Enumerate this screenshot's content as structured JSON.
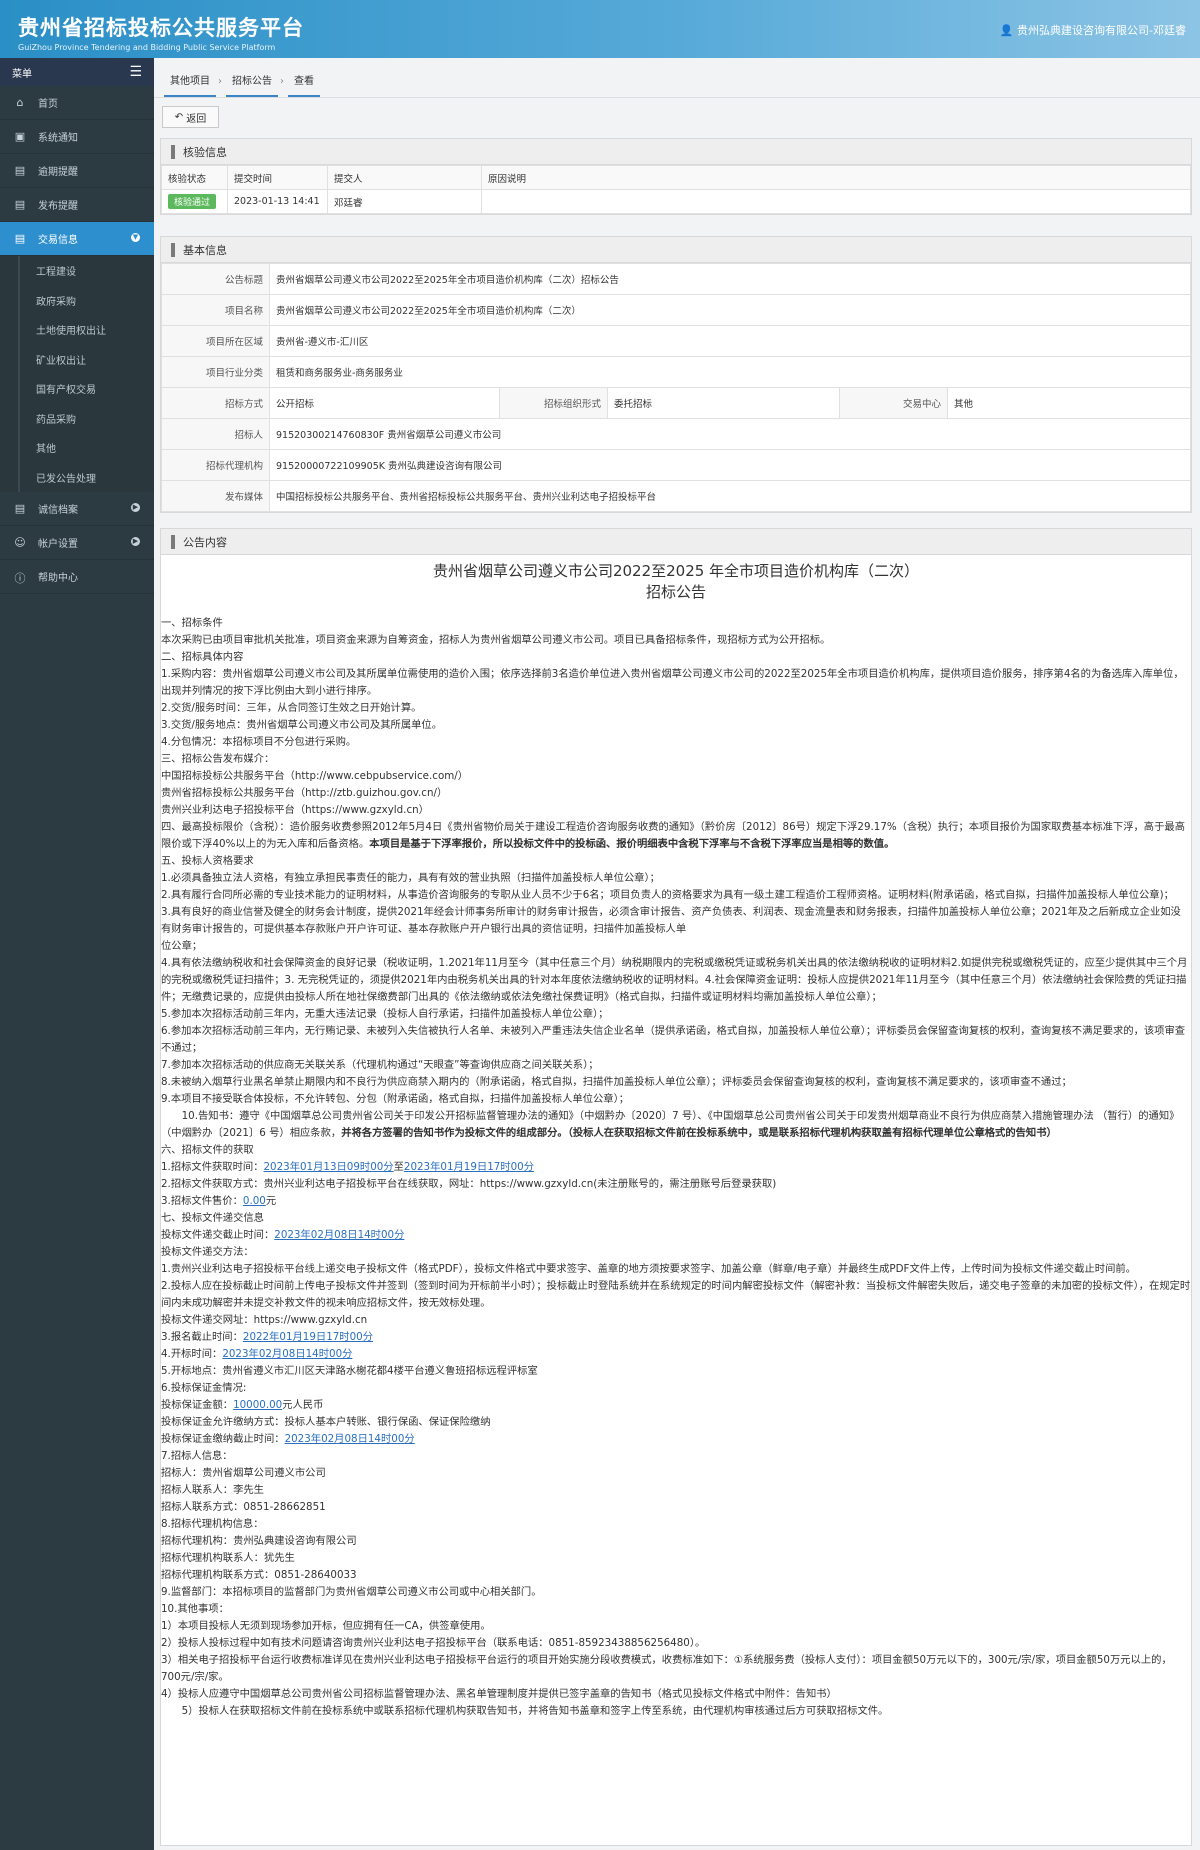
{
  "header": {
    "title": "贵州省招标投标公共服务平台",
    "subtitle": "GuiZhou Province Tendering and Bidding Public Service Platform",
    "user": "贵州弘典建设咨询有限公司-邓廷睿"
  },
  "sidebar": {
    "menu_label": "菜单",
    "items": [
      {
        "label": "首页",
        "icon": "home-icon"
      },
      {
        "label": "系统通知",
        "icon": "monitor-icon"
      },
      {
        "label": "逾期提醒",
        "icon": "list-icon"
      },
      {
        "label": "发布提醒",
        "icon": "list-icon"
      },
      {
        "label": "交易信息",
        "icon": "list-icon"
      }
    ],
    "sub_items": [
      "工程建设",
      "政府采购",
      "土地使用权出让",
      "矿业权出让",
      "国有产权交易",
      "药品采购",
      "其他",
      "已发公告处理"
    ],
    "bottom_items": [
      {
        "label": "诚信档案",
        "icon": "list-icon"
      },
      {
        "label": "帐户设置",
        "icon": "user-icon"
      },
      {
        "label": "帮助中心",
        "icon": "help-icon"
      }
    ]
  },
  "breadcrumb": [
    "其他项目",
    "招标公告",
    "查看"
  ],
  "back_label": "返回",
  "verify": {
    "title": "核验信息",
    "headers": [
      "核验状态",
      "提交时间",
      "提交人",
      "原因说明"
    ],
    "status": "核验通过",
    "time": "2023-01-13 14:41",
    "submitter": "邓廷睿",
    "reason": ""
  },
  "basic": {
    "title": "基本信息",
    "rows": [
      {
        "label": "公告标题",
        "value": "贵州省烟草公司遵义市公司2022至2025年全市项目造价机构库（二次）招标公告"
      },
      {
        "label": "项目名称",
        "value": "贵州省烟草公司遵义市公司2022至2025年全市项目造价机构库（二次）"
      },
      {
        "label": "项目所在区域",
        "value": "贵州省-遵义市-汇川区"
      },
      {
        "label": "项目行业分类",
        "value": "租赁和商务服务业-商务服务业"
      }
    ],
    "method_label": "招标方式",
    "method": "公开招标",
    "org_label": "招标组织形式",
    "org": "委托招标",
    "center_label": "交易中心",
    "center": "其他",
    "tenderer_label": "招标人",
    "tenderer": "91520300214760830F 贵州省烟草公司遵义市公司",
    "agent_label": "招标代理机构",
    "agent": "91520000722109905K 贵州弘典建设咨询有限公司",
    "media_label": "发布媒体",
    "media": "中国招标投标公共服务平台、贵州省招标投标公共服务平台、贵州兴业利达电子招投标平台"
  },
  "notice": {
    "title": "公告内容",
    "heading1": "贵州省烟草公司遵义市公司2022至2025 年全市项目造价机构库（二次）",
    "heading2": "招标公告",
    "l1": "一、招标条件",
    "l2": "本次采购已由项目审批机关批准，项目资金来源为自筹资金，招标人为贵州省烟草公司遵义市公司。项目已具备招标条件，现招标方式为公开招标。",
    "l3": "二、招标具体内容",
    "l4": "1.采购内容：贵州省烟草公司遵义市公司及其所属单位需使用的造价入围；依序选择前3名造价单位进入贵州省烟草公司遵义市公司的2022至2025年全市项目造价机构库，提供项目造价服务，排序第4名的为备选库入库单位，出现并列情况的按下浮比例由大到小进行排序。",
    "l5": "2.交货/服务时间：三年，从合同签订生效之日开始计算。",
    "l6": "3.交货/服务地点：贵州省烟草公司遵义市公司及其所属单位。",
    "l7": "4.分包情况：本招标项目不分包进行采购。",
    "l8": "三、招标公告发布媒介：",
    "l9": "中国招标投标公共服务平台（http://www.cebpubservice.com/）",
    "l10": "贵州省招标投标公共服务平台（http://ztb.guizhou.gov.cn/）",
    "l11": "贵州兴业利达电子招投标平台（https://www.gzxyld.cn）",
    "l12a": "四、最高投标限价（含税）：造价服务收费参照2012年5月4日《贵州省物价局关于建设工程造价咨询服务收费的通知》（黔价房〔2012〕86号）规定下浮29.17%（含税）执行；本项目报价为国家取费基本标准下浮，高于最高限价或下浮40%以上的为无入库和后备资格。",
    "l12b": "本项目是基于下浮率报价，所以投标文件中的投标函、报价明细表中含税下浮率与不含税下浮率应当是相等的数值。",
    "l13": "五、投标人资格要求",
    "l14": "1.必须具备独立法人资格，有独立承担民事责任的能力，具有有效的营业执照（扫描件加盖投标人单位公章）；",
    "l15": "2.具有履行合同所必需的专业技术能力的证明材料，从事造价咨询服务的专职从业人员不少于6名；项目负责人的资格要求为具有一级土建工程造价工程师资格。证明材料(附承诺函，格式自拟，扫描件加盖投标人单位公章)；",
    "l16": "3.具有良好的商业信誉及健全的财务会计制度，提供2021年经会计师事务所审计的财务审计报告，必须含审计报告、资产负债表、利润表、现金流量表和财务报表，扫描件加盖投标人单位公章；2021年及之后新成立企业如没有财务审计报告的，可提供基本存款账户开户许可证、基本存款账户开户银行出具的资信证明，扫描件加盖投标人单",
    "l16b": "位公章；",
    "l17": "4.具有依法缴纳税收和社会保障资金的良好记录（税收证明，1.2021年11月至今（其中任意三个月）纳税期限内的完税或缴税凭证或税务机关出具的依法缴纳税收的证明材料2.如提供完税或缴税凭证的，应至少提供其中三个月的完税或缴税凭证扫描件；3. 无完税凭证的，须提供2021年内由税务机关出具的针对本年度依法缴纳税收的证明材料。4.社会保障资金证明：投标人应提供2021年11月至今（其中任意三个月）依法缴纳社会保险费的凭证扫描件；无缴费记录的，应提供由投标人所在地社保缴费部门出具的《依法缴纳或依法免缴社保费证明》（格式自拟，扫描件或证明材料均需加盖投标人单位公章）；",
    "l18": "5.参加本次招标活动前三年内，无重大违法记录（投标人自行承诺，扫描件加盖投标人单位公章）；",
    "l19": "6.参加本次招标活动前三年内，无行贿记录、未被列入失信被执行人名单、未被列入严重违法失信企业名单（提供承诺函，格式自拟，加盖投标人单位公章）；评标委员会保留查询复核的权利，查询复核不满足要求的，该项审查不通过；",
    "l20": "7.参加本次招标活动的供应商无关联关系（代理机构通过“天眼查”等查询供应商之间关联关系）；",
    "l21": "8.未被纳入烟草行业黑名单禁止期限内和不良行为供应商禁入期内的（附承诺函，格式自拟，扫描件加盖投标人单位公章）；评标委员会保留查询复核的权利，查询复核不满足要求的，该项审查不通过；",
    "l22": "9.本项目不接受联合体投标，不允许转包、分包（附承诺函，格式自拟，扫描件加盖投标人单位公章）；",
    "l23a": "　　10.告知书：遵守《中国烟草总公司贵州省公司关于印发公开招标监督管理办法的通知》（中烟黔办〔2020〕7 号）、《中国烟草总公司贵州省公司关于印发贵州烟草商业不良行为供应商禁入措施管理办法 （暂行）的通知》（中烟黔办〔2021〕6 号）相应条款，",
    "l23b": "并将各方签署的告知书作为投标文件的组成部分。（投标人在获取招标文件前在投标系统中，或是联系招标代理机构获取盖有招标代理单位公章格式的告知书）",
    "l24": "六、招标文件的获取",
    "l25a": "1.招标文件获取时间：",
    "l25b": "2023年01月13日09时00分",
    "l25c": "至",
    "l25d": "2023年01月19日17时00分",
    "l26": "2.招标文件获取方式：贵州兴业利达电子招投标平台在线获取，网址：https://www.gzxyld.cn(未注册账号的，需注册账号后登录获取)",
    "l27a": "3.招标文件售价：",
    "l27b": "0.00",
    "l27c": "元",
    "l28": "七、投标文件递交信息",
    "l29a": "投标文件递交截止时间：",
    "l29b": "2023年02月08日14时00分",
    "l30": "投标文件递交方法：",
    "l31": "1.贵州兴业利达电子招投标平台线上递交电子投标文件（格式PDF），投标文件格式中要求签字、盖章的地方须按要求签字、加盖公章（鲜章/电子章）并最终生成PDF文件上传，上传时间为投标文件递交截止时间前。",
    "l32": "2.投标人应在投标截止时间前上传电子投标文件并签到（签到时间为开标前半小时）；投标截止时登陆系统并在系统规定的时间内解密投标文件（解密补救：当投标文件解密失败后，递交电子签章的未加密的投标文件），在规定时间内未成功解密并未提交补救文件的视未响应招标文件，按无效标处理。",
    "l33": "投标文件递交网址：https://www.gzxyld.cn",
    "l34a": "3.报名截止时间：",
    "l34b": "2022年01月19日17时00分",
    "l35a": "4.开标时间：",
    "l35b": "2023年02月08日14时00分",
    "l36": "5.开标地点：贵州省遵义市汇川区天津路水榭花都4楼平台遵义鲁班招标远程评标室",
    "l37": "6.投标保证金情况:",
    "l38a": "投标保证金额：",
    "l38b": "10000.00",
    "l38c": "元人民币",
    "l39": "投标保证金允许缴纳方式：投标人基本户转账、银行保函、保证保险缴纳",
    "l40a": "投标保证金缴纳截止时间：",
    "l40b": "2023年02月08日14时00分",
    "l41": "7.招标人信息：",
    "l42": "招标人：贵州省烟草公司遵义市公司",
    "l43": "招标人联系人：李先生",
    "l44": "招标人联系方式：0851-28662851",
    "l45": "8.招标代理机构信息：",
    "l46": "招标代理机构：贵州弘典建设咨询有限公司",
    "l47": "招标代理机构联系人：犹先生",
    "l48": "招标代理机构联系方式：0851-28640033",
    "l49": "9.监督部门：本招标项目的监督部门为贵州省烟草公司遵义市公司或中心相关部门。",
    "l50": "10.其他事项：",
    "l51": "1）本项目投标人无须到现场参加开标，但应拥有任一CA，供签章使用。",
    "l52": "2）投标人投标过程中如有技术问题请咨询贵州兴业利达电子招投标平台（联系电话：0851-85923438856256480）。",
    "l53": "3）相关电子招投标平台运行收费标准详见在贵州兴业利达电子招投标平台运行的项目开始实施分段收费模式，收费标准如下：①系统服务费（投标人支付）：项目金额50万元以下的，300元/宗/家，项目金额50万元以上的，700元/宗/家。",
    "l54": "4）投标人应遵守中国烟草总公司贵州省公司招标监督管理办法、黑名单管理制度并提供已签字盖章的告知书（格式见投标文件格式中附件：告知书）",
    "l55": "　　5）投标人在获取招标文件前在投标系统中或联系招标代理机构获取告知书，并将告知书盖章和签字上传至系统，由代理机构审核通过后方可获取招标文件。"
  }
}
